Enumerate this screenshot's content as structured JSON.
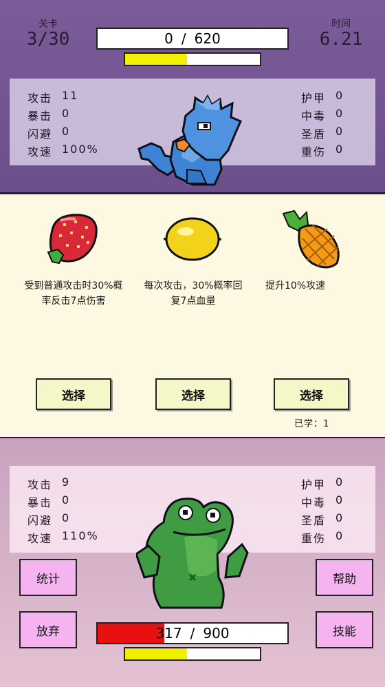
{
  "header": {
    "level_label": "关卡",
    "level_value": "3/30",
    "time_label": "时间",
    "time_value": "6.21"
  },
  "enemy": {
    "hp_current": "0",
    "hp_sep": "/",
    "hp_max": "620",
    "hp_fraction": 0.0,
    "energy_fraction": 0.46,
    "stats_left": [
      {
        "label": "攻击",
        "value": "11"
      },
      {
        "label": "暴击",
        "value": "0"
      },
      {
        "label": "闪避",
        "value": "0"
      },
      {
        "label": "攻速",
        "value": "100%"
      }
    ],
    "stats_right": [
      {
        "label": "护甲",
        "value": "0"
      },
      {
        "label": "中毒",
        "value": "0"
      },
      {
        "label": "圣盾",
        "value": "0"
      },
      {
        "label": "重伤",
        "value": "0"
      }
    ],
    "sprite_icon": "blue-dragon-icon"
  },
  "choices": [
    {
      "icon": "strawberry-icon",
      "description": "受到普通攻击时30%概率反击7点伤害",
      "button": "选择"
    },
    {
      "icon": "lemon-icon",
      "description": "每次攻击，30%概率回复7点血量",
      "button": "选择"
    },
    {
      "icon": "pineapple-icon",
      "description": "提升10%攻速",
      "button": "选择",
      "learned": "已学：1"
    }
  ],
  "player": {
    "hp_current": "317",
    "hp_sep": "/",
    "hp_max": "900",
    "hp_fraction": 0.352,
    "energy_fraction": 0.46,
    "stats_left": [
      {
        "label": "攻击",
        "value": "9"
      },
      {
        "label": "暴击",
        "value": "0"
      },
      {
        "label": "闪避",
        "value": "0"
      },
      {
        "label": "攻速",
        "value": "110%"
      }
    ],
    "stats_right": [
      {
        "label": "护甲",
        "value": "0"
      },
      {
        "label": "中毒",
        "value": "0"
      },
      {
        "label": "圣盾",
        "value": "0"
      },
      {
        "label": "重伤",
        "value": "0"
      }
    ],
    "sprite_icon": "green-frog-icon"
  },
  "buttons": {
    "stats": "统计",
    "help": "帮助",
    "give_up": "放弃",
    "skills": "技能"
  },
  "colors": {
    "top_bg": "#6b4f8c",
    "bottom_bg": "#dcb7cc",
    "hp_fill": "#e81010",
    "energy_fill": "#f0f000",
    "button_pink": "#f5b3ef",
    "choose_btn": "#f4f7c8"
  }
}
